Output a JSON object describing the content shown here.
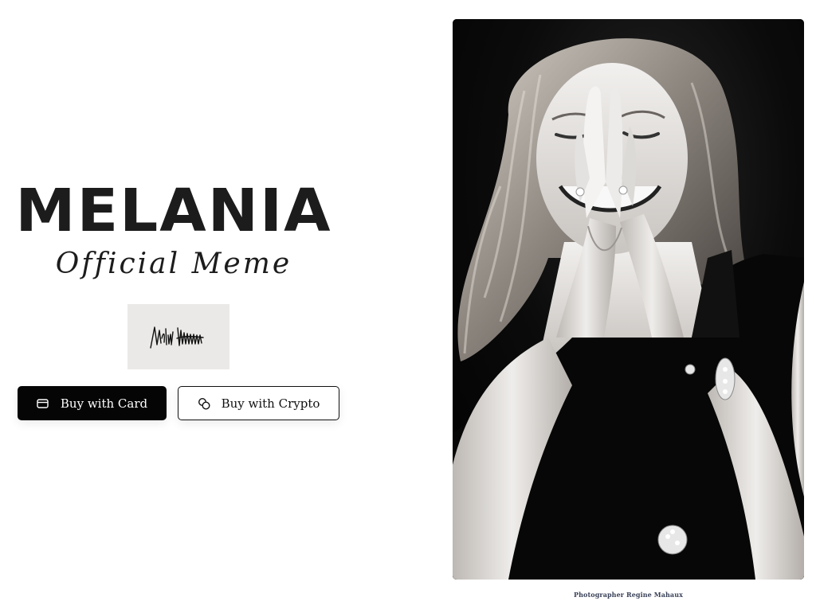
{
  "hero": {
    "title": "MELANIA",
    "subtitle": "Official Meme"
  },
  "signature": {
    "text": "Melania Trump"
  },
  "buttons": {
    "card_label": "Buy with Card",
    "card_icon": "credit-card-icon",
    "crypto_label": "Buy with Crypto",
    "crypto_icon": "coins-icon"
  },
  "photo": {
    "caption": "Photographer Regine Mahaux",
    "style": "black-and-white portrait"
  },
  "colors": {
    "primary_button_bg": "#050505",
    "primary_button_text": "#ffffff",
    "secondary_button_border": "#111111",
    "signature_bg": "#ebe9e7",
    "caption_text": "#3a4258"
  }
}
